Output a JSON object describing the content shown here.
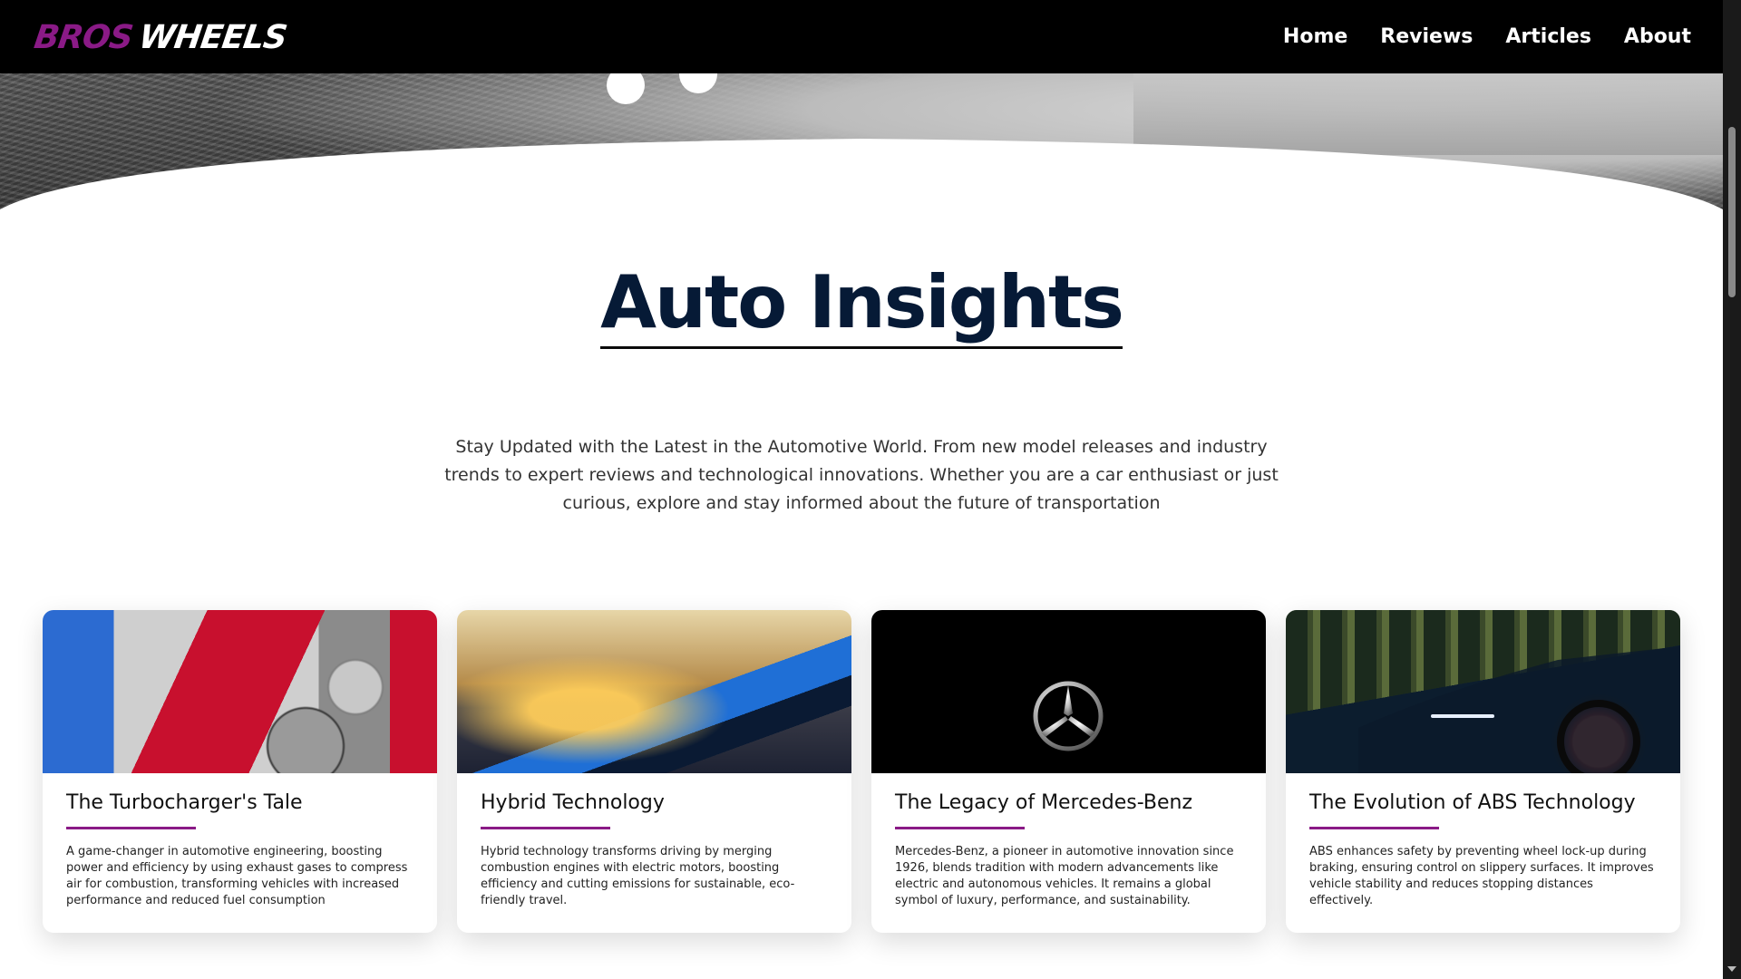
{
  "brand": {
    "part1": "BROS",
    "part2": "WHEELS"
  },
  "nav": {
    "items": [
      "Home",
      "Reviews",
      "Articles",
      "About"
    ]
  },
  "section": {
    "title": "Auto Insights",
    "intro": "Stay Updated with the Latest in the Automotive World. From new model releases and industry trends to expert reviews and technological innovations. Whether you are a car enthusiast or just curious, explore and stay informed about the future of transportation"
  },
  "cards": [
    {
      "title": "The Turbocharger's Tale",
      "description": "A game-changer in automotive engineering, boosting power and efficiency by using exhaust gases to compress air for combustion, transforming vehicles with increased performance and reduced fuel consumption"
    },
    {
      "title": "Hybrid Technology",
      "description": "Hybrid technology transforms driving by merging combustion engines with electric motors, boosting efficiency and cutting emissions for sustainable, eco-friendly travel."
    },
    {
      "title": "The Legacy of Mercedes-Benz",
      "description": "Mercedes-Benz, a pioneer in automotive innovation since 1926, blends tradition with modern advancements like electric and autonomous vehicles. It remains a global symbol of luxury, performance, and sustainability."
    },
    {
      "title": "The Evolution of ABS Technology",
      "description": "ABS enhances safety by preventing wheel lock-up during braking, ensuring control on slippery surfaces. It improves vehicle stability and reduces stopping distances effectively."
    }
  ],
  "colors": {
    "accent": "#8a1a86",
    "title": "#061a36",
    "nav_bg": "#000000"
  },
  "icons": {
    "mercedes_logo": "mercedes-star-icon"
  }
}
